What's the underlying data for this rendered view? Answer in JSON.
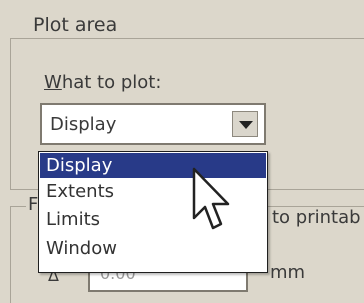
{
  "plot_area": {
    "group_title": "Plot area",
    "what_to_plot_label_accel": "W",
    "what_to_plot_label_rest": "hat to plot:",
    "selected_value": "Display",
    "options": [
      "Display",
      "Extents",
      "Limits",
      "Window"
    ],
    "selected_index": 0
  },
  "background_group": {
    "title_initial": "F",
    "partial_text": "to printab",
    "offset_value": "0.00",
    "unit": "mm",
    "field_icon": "Δ"
  },
  "icons": {
    "dropdown_arrow": "chevron-down-icon",
    "cursor": "mouse-pointer-icon",
    "field_icon": "delta-icon"
  },
  "colors": {
    "selection": "#283a88",
    "dialog_bg": "#dcd7cb"
  }
}
